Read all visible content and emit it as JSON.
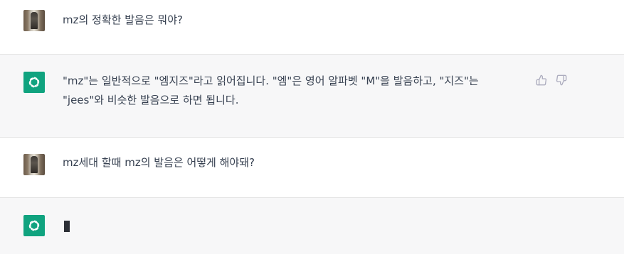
{
  "conversation": {
    "messages": [
      {
        "role": "user",
        "text": "mz의 정확한 발음은 뭐야?"
      },
      {
        "role": "assistant",
        "line1": "\"mz\"는 일반적으로 \"엠지즈\"라고 읽어집니다. \"엠\"은 영어 알파벳 \"M\"을 발음하고, \"지즈\"는",
        "line2": "\"jees\"와 비슷한 발음으로 하면 됩니다."
      },
      {
        "role": "user",
        "text": "mz세대 할때 mz의 발음은 어떻게 해야돼?"
      },
      {
        "role": "assistant",
        "text": ""
      }
    ]
  },
  "icons": {
    "user_avatar": "user-photo-avatar",
    "bot_avatar": "openai-logo-icon",
    "thumbs_up": "thumbs-up-icon",
    "thumbs_down": "thumbs-down-icon"
  },
  "colors": {
    "assistant_bg": "#f7f7f8",
    "bot_avatar_bg": "#10a37f",
    "text": "#374151"
  }
}
